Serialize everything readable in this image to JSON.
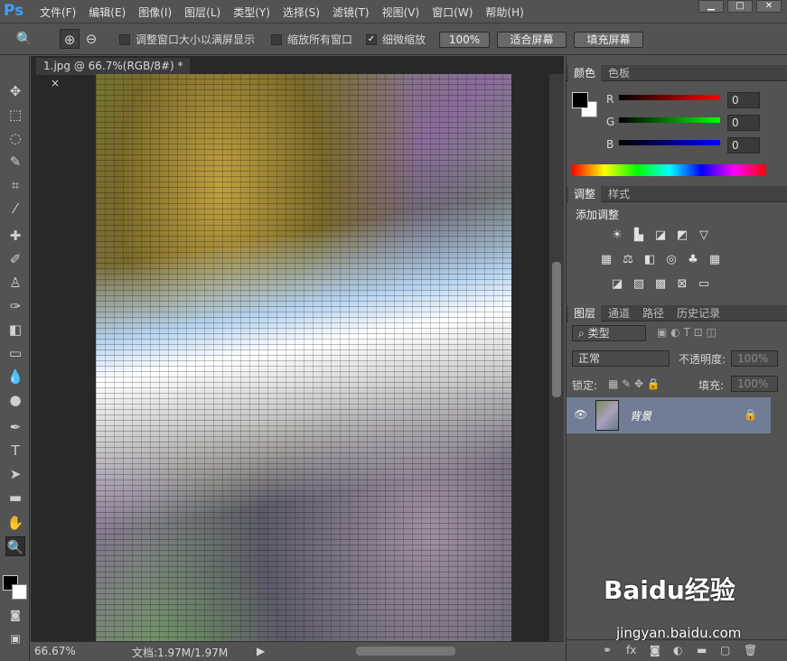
{
  "app": {
    "logo": "Ps"
  },
  "menu": [
    "文件(F)",
    "编辑(E)",
    "图像(I)",
    "图层(L)",
    "类型(Y)",
    "选择(S)",
    "滤镜(T)",
    "视图(V)",
    "窗口(W)",
    "帮助(H)"
  ],
  "window_buttons": [
    "▁",
    "□",
    "✕"
  ],
  "options": {
    "resize_windows": "调整窗口大小以满屏显示",
    "zoom_all": "缩放所有窗口",
    "scrubby_zoom": "细微缩放",
    "btn_100": "100%",
    "btn_fit": "适合屏幕",
    "btn_fill": "填充屏幕"
  },
  "document": {
    "tab_title": "1.jpg @ 66.7%(RGB/8#) *",
    "close": "×"
  },
  "status": {
    "zoom": "66.67%",
    "doc_info": "文档:1.97M/1.97M"
  },
  "color_panel": {
    "tabs": [
      "颜色",
      "色板"
    ],
    "r_label": "R",
    "g_label": "G",
    "b_label": "B",
    "r_value": "0",
    "g_value": "0",
    "b_value": "0"
  },
  "adjust_panel": {
    "tabs": [
      "调整",
      "样式"
    ],
    "title": "添加调整"
  },
  "layers_panel": {
    "tabs": [
      "图层",
      "通道",
      "路径",
      "历史记录"
    ],
    "filter": "类型",
    "blend_mode": "正常",
    "opacity_label": "不透明度:",
    "opacity_value": "100%",
    "lock_label": "锁定:",
    "fill_label": "填充:",
    "fill_value": "100%",
    "layer_name": "背景"
  },
  "watermark": {
    "brand": "Baidu经验",
    "url": "jingyan.baidu.com"
  },
  "colors": {
    "accent": "#3ba0ff",
    "panel_bg": "#535353",
    "selected_layer": "#707d94"
  }
}
